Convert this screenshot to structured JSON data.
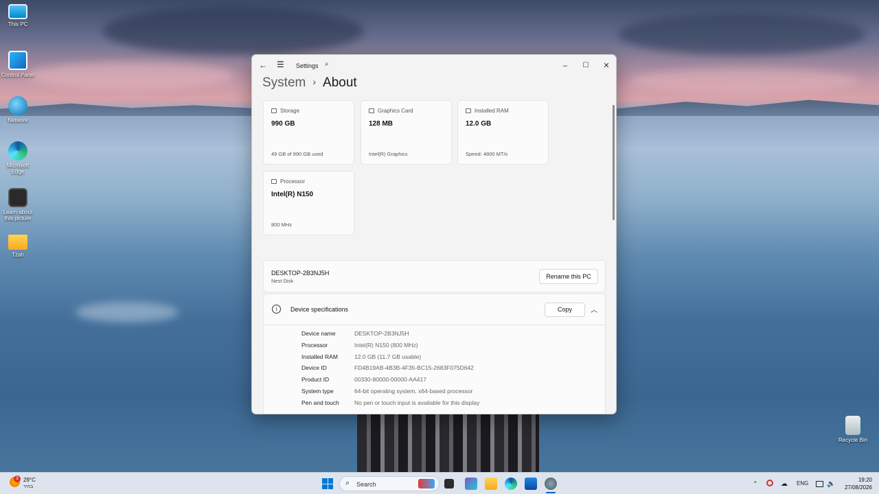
{
  "desktop": {
    "icons": [
      {
        "label": "This PC",
        "icon": "monitor-icon"
      },
      {
        "label": "Control Panel",
        "icon": "control-panel-icon"
      },
      {
        "label": "Network",
        "icon": "network-icon"
      },
      {
        "label": "Microsoft Edge",
        "icon": "edge-icon"
      },
      {
        "label": "Learn about this picture",
        "icon": "camera-icon"
      },
      {
        "label": "Tzah",
        "icon": "folder-icon"
      },
      {
        "label": "Recycle Bin",
        "icon": "recycle-bin-icon"
      }
    ]
  },
  "window": {
    "title": "Settings",
    "breadcrumb": {
      "parent": "System",
      "current": "About"
    },
    "cards": [
      {
        "label": "Storage",
        "value": "990 GB",
        "sub": "49 GB of 990 GB used"
      },
      {
        "label": "Graphics Card",
        "value": "128 MB",
        "sub": "Intel(R) Graphics"
      },
      {
        "label": "Installed RAM",
        "value": "12.0 GB",
        "sub": "Speed: 4800 MT/s"
      },
      {
        "label": "Processor",
        "value": "Intel(R) N150",
        "sub": "800 MHz"
      }
    ],
    "pc": {
      "name": "DESKTOP-2B3NJ5H",
      "subtitle": "Nest Disk",
      "rename_label": "Rename this PC"
    },
    "specs": {
      "title": "Device specifications",
      "copy_label": "Copy",
      "rows": [
        {
          "key": "Device name",
          "value": "DESKTOP-2B3NJ5H"
        },
        {
          "key": "Processor",
          "value": "Intel(R) N150 (800 MHz)"
        },
        {
          "key": "Installed RAM",
          "value": "12.0 GB (11.7 GB usable)"
        },
        {
          "key": "Device ID",
          "value": "FD4B19AB-4B3B-4F35-BC15-2683F075D642"
        },
        {
          "key": "Product ID",
          "value": "00330-80000-00000-AA417"
        },
        {
          "key": "System type",
          "value": "64-bit operating system, x64-based processor"
        },
        {
          "key": "Pen and touch",
          "value": "No pen or touch input is available for this display"
        }
      ]
    }
  },
  "taskbar": {
    "weather": {
      "temp": "29°C",
      "desc": "בהיר",
      "badge": "3"
    },
    "search_placeholder": "Search",
    "language": "ENG",
    "time": "19:20",
    "date": "27/08/2026"
  },
  "colors": {
    "accent": "#0067c0",
    "window_bg": "#f3f3f3",
    "card_bg": "#fbfbfb"
  }
}
